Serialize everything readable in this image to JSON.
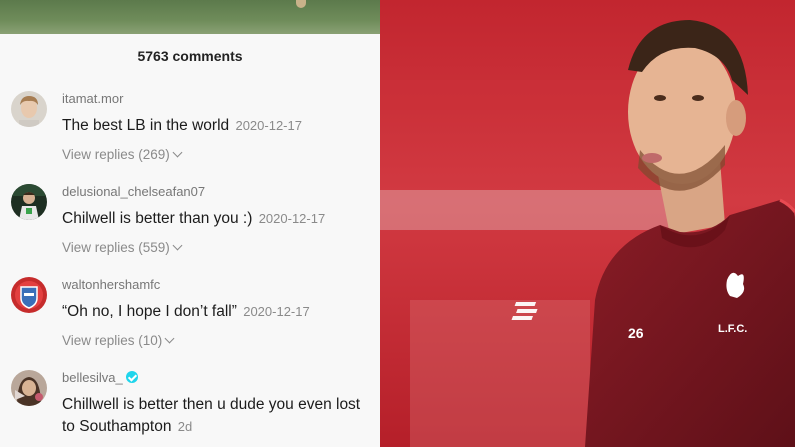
{
  "comments_header": {
    "count_label": "5763 comments"
  },
  "comments": [
    {
      "username": "itamat.mor",
      "verified": false,
      "text": "The best LB in the world",
      "date": "2020-12-17",
      "replies": "View replies (269)",
      "avatar": "young-man-avatar-icon"
    },
    {
      "username": "delusional_chelseafan07",
      "verified": false,
      "text": "Chilwell is better than you :)",
      "date": "2020-12-17",
      "replies": "View replies (559)",
      "avatar": "footballer-avatar-icon"
    },
    {
      "username": "waltonhershamfc",
      "verified": false,
      "text": "“Oh no, I hope I don’t fall”",
      "date": "2020-12-17",
      "replies": "View replies (10)",
      "avatar": "club-crest-avatar-icon"
    },
    {
      "username": "bellesilva_",
      "verified": true,
      "text": "Chillwell is better then u dude you even lost to Southampton",
      "date": "2d",
      "replies": "",
      "avatar": "woman-avatar-icon"
    }
  ],
  "photo": {
    "jersey_number": "26",
    "crest_text": "L.F.C.",
    "colors": {
      "jersey": "#7a1620",
      "background": "#b8222c",
      "accent": "#ffffff"
    }
  }
}
